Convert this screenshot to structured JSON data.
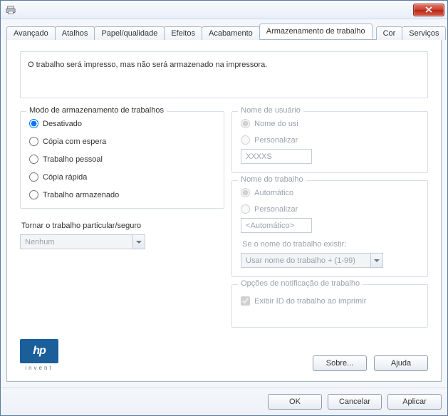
{
  "titlebar": {
    "title": ""
  },
  "tabs": [
    {
      "label": "Avançado"
    },
    {
      "label": "Atalhos"
    },
    {
      "label": "Papel/qualidade"
    },
    {
      "label": "Efeitos"
    },
    {
      "label": "Acabamento"
    },
    {
      "label": "Armazenamento de trabalho"
    },
    {
      "label": "Cor"
    },
    {
      "label": "Serviços"
    }
  ],
  "active_tab_index": 5,
  "description": "O trabalho será impresso, mas não será armazenado na impressora.",
  "storage_mode": {
    "legend": "Modo de armazenamento de trabalhos",
    "options": [
      "Desativado",
      "Cópia com espera",
      "Trabalho pessoal",
      "Cópia rápida",
      "Trabalho armazenado"
    ],
    "selected_index": 0
  },
  "secure": {
    "label": "Tornar o trabalho particular/seguro",
    "value": "Nenhum",
    "enabled": false
  },
  "username": {
    "legend": "Nome de usuário",
    "options": [
      "Nome do usi",
      "Personalizar"
    ],
    "selected_index": 0,
    "custom_value": "XXXXS",
    "enabled": false
  },
  "jobname": {
    "legend": "Nome do trabalho",
    "options": [
      "Automático",
      "Personalizar"
    ],
    "selected_index": 0,
    "custom_value": "<Automático>",
    "exists_label": "Se o nome do trabalho existir:",
    "exists_value": "Usar nome do trabalho + (1-99)",
    "enabled": false
  },
  "notify": {
    "legend": "Opções de notificação de trabalho",
    "checkbox_label": "Exibir ID do trabalho ao imprimir",
    "checked": true,
    "enabled": false
  },
  "logo": {
    "name": "hp",
    "caption": "invent"
  },
  "buttons": {
    "about": "Sobre...",
    "help": "Ajuda",
    "ok": "OK",
    "cancel": "Cancelar",
    "apply": "Aplicar"
  }
}
